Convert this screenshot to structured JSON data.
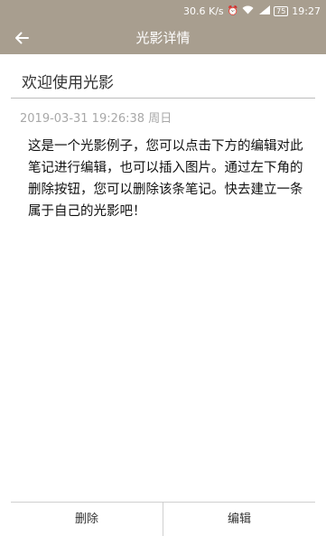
{
  "status_bar": {
    "network_speed": "30.6 K/s",
    "battery": "75",
    "time": "19:27",
    "icons": [
      "alarm-icon",
      "wifi-icon",
      "4g-signal-icon",
      "battery-icon"
    ]
  },
  "app_bar": {
    "back_icon": "arrow-left-icon",
    "title": "光影详情"
  },
  "note": {
    "title": "欢迎使用光影",
    "date": "2019-03-31 19:26:38 周日",
    "body": "这是一个光影例子，您可以点击下方的编辑对此笔记进行编辑，也可以插入图片。通过左下角的删除按钮，您可以删除该条笔记。快去建立一条属于自己的光影吧！"
  },
  "bottom_actions": {
    "delete_label": "删除",
    "edit_label": "编辑"
  },
  "colors": {
    "app_bar_bg": "#a89e8f",
    "divider": "#bdbdbd",
    "date_text": "#a8a8a8"
  }
}
